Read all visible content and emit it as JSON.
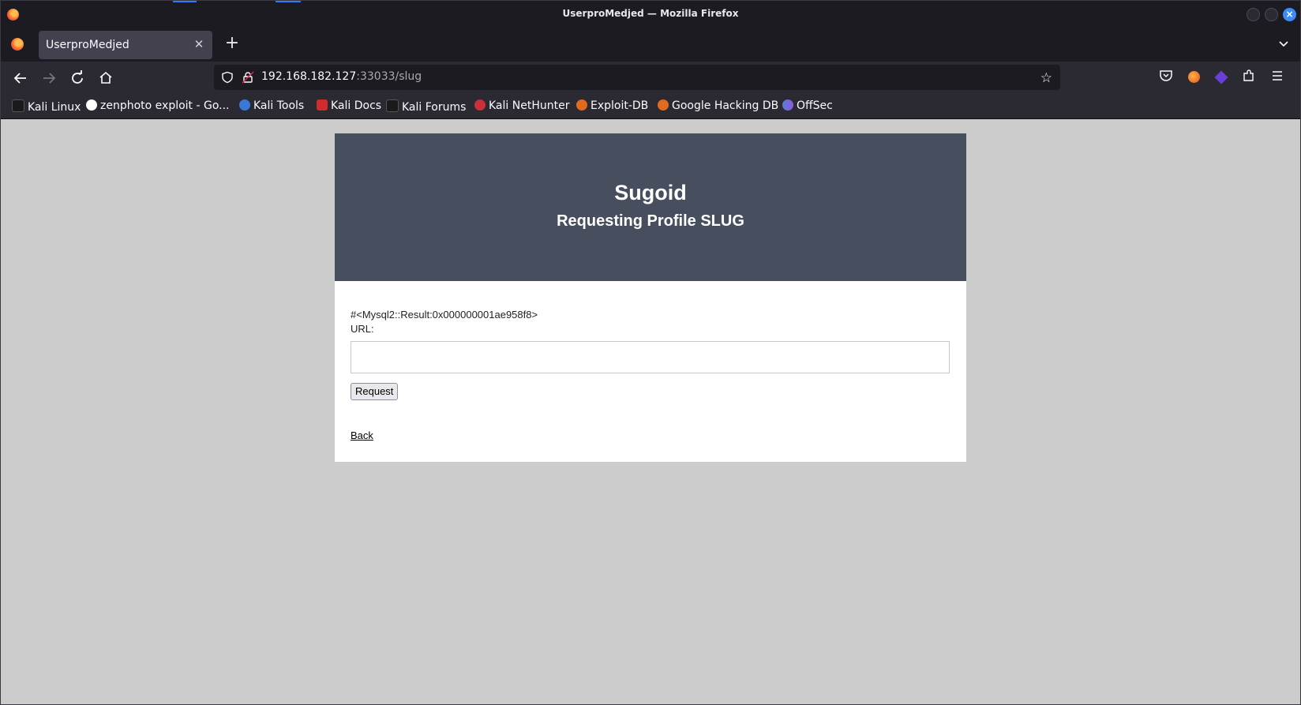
{
  "window": {
    "title": "UserproMedjed — Mozilla Firefox"
  },
  "tabs": [
    {
      "label": "UserproMedjed",
      "active": true
    }
  ],
  "navbar": {
    "url_host": "192.168.182.127",
    "url_rest": ":33033/slug"
  },
  "bookmarks": [
    {
      "label": "Kali Linux",
      "icon": "kali-dragon-icon"
    },
    {
      "label": "zenphoto exploit - Go...",
      "icon": "google-icon"
    },
    {
      "label": "Kali Tools",
      "icon": "kali-tools-icon"
    },
    {
      "label": "Kali Docs",
      "icon": "kali-docs-icon"
    },
    {
      "label": "Kali Forums",
      "icon": "kali-dragon-icon"
    },
    {
      "label": "Kali NetHunter",
      "icon": "nethunter-icon"
    },
    {
      "label": "Exploit-DB",
      "icon": "exploitdb-icon"
    },
    {
      "label": "Google Hacking DB",
      "icon": "ghdb-icon"
    },
    {
      "label": "OffSec",
      "icon": "offsec-icon"
    }
  ],
  "page": {
    "heading": "Sugoid",
    "subheading": "Requesting Profile SLUG",
    "result_text": "#<Mysql2::Result:0x000000001ae958f8>",
    "url_label": "URL:",
    "url_value": "",
    "request_button": "Request",
    "back_link": "Back"
  },
  "colors": {
    "header_bg": "#474e5d",
    "page_bg": "#cccccc",
    "chrome_dark": "#1c1b22",
    "chrome_toolbar": "#2b2a33",
    "accent": "#3b8cf7"
  }
}
